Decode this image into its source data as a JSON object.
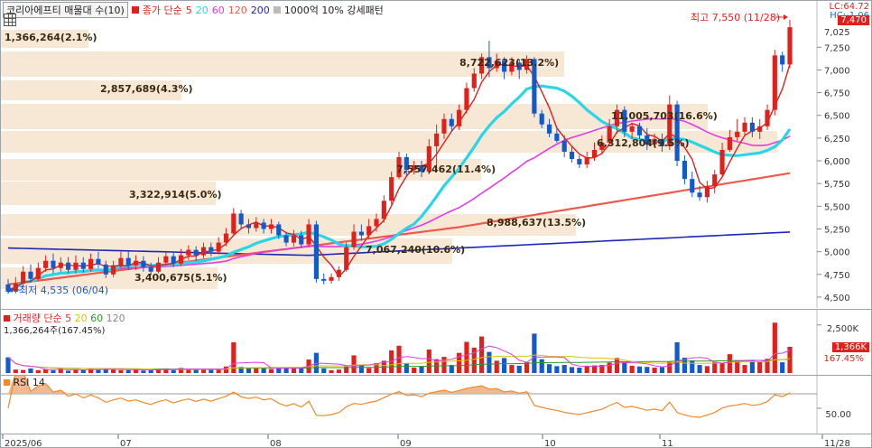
{
  "header": {
    "title": "코리아에프티 매물대 수(10)",
    "ma_label": "종가 단순",
    "ma_periods": [
      "5",
      "20",
      "60",
      "120",
      "200"
    ],
    "ma_colors": [
      "#e0201c",
      "#2ad5e8",
      "#e23de0",
      "#ec5a4c",
      "#1d27b8"
    ],
    "extra_label": "1000억 10% 강세패턴",
    "right_lc": "LC:64.72",
    "right_hc": "HC:-1.06"
  },
  "volume_legend": {
    "label": "거래량",
    "ma_label": "단순",
    "ma_periods": [
      "5",
      "20",
      "60",
      "120"
    ],
    "ma_colors": [
      "#e8302a",
      "#d7c400",
      "#2a9b2a",
      "#888888"
    ],
    "value_text": "1,366,264주(167.45%)",
    "tag_value": "1,366K",
    "tag_pct": "167.45%",
    "axis_label": "2,500K"
  },
  "rsi_legend": {
    "label": "RSI 14",
    "axis_label": "50.00"
  },
  "price_tag": "7,470",
  "price_axis": [
    "7,250",
    "7,000",
    "6,750",
    "6,500",
    "6,250",
    "6,000",
    "5,750",
    "5,500",
    "5,250",
    "5,000",
    "4,750",
    "4,500"
  ],
  "top_axis_label": "7,025",
  "annotations": {
    "high": "최고 7,550 (11/28)",
    "low": "최저 4,535 (06/04)"
  },
  "x_axis": [
    "2025/06",
    "07",
    "08",
    "09",
    "10",
    "11",
    "11/28"
  ],
  "chart_data": {
    "type": "candlestick",
    "title": "코리아에프티 매물대 수(10)",
    "ylim": [
      4420,
      7700
    ],
    "yticks": [
      4500,
      4750,
      5000,
      5250,
      5500,
      5750,
      6000,
      6250,
      6500,
      6750,
      7000,
      7250
    ],
    "high": {
      "value": 7550,
      "date": "11/28"
    },
    "low": {
      "value": 4535,
      "date": "06/04"
    },
    "candles": [
      [
        4640,
        4560,
        4700,
        4535
      ],
      [
        4560,
        4650,
        4720,
        4540
      ],
      [
        4650,
        4780,
        4840,
        4610
      ],
      [
        4780,
        4700,
        4860,
        4660
      ],
      [
        4700,
        4820,
        4880,
        4680
      ],
      [
        4820,
        4900,
        4960,
        4780
      ],
      [
        4900,
        4820,
        4980,
        4760
      ],
      [
        4820,
        4880,
        4940,
        4780
      ],
      [
        4880,
        4800,
        4940,
        4760
      ],
      [
        4800,
        4880,
        4960,
        4760
      ],
      [
        4880,
        4810,
        4940,
        4770
      ],
      [
        4810,
        4920,
        4980,
        4780
      ],
      [
        4920,
        4860,
        5000,
        4820
      ],
      [
        4860,
        4750,
        4900,
        4710
      ],
      [
        4750,
        4850,
        4900,
        4720
      ],
      [
        4850,
        4930,
        5000,
        4820
      ],
      [
        4930,
        4850,
        5000,
        4800
      ],
      [
        4850,
        4900,
        4960,
        4800
      ],
      [
        4900,
        4830,
        4950,
        4780
      ],
      [
        4830,
        4780,
        4880,
        4740
      ],
      [
        4780,
        4880,
        4940,
        4760
      ],
      [
        4880,
        4950,
        5010,
        4850
      ],
      [
        4950,
        4870,
        5000,
        4830
      ],
      [
        4870,
        4960,
        5030,
        4840
      ],
      [
        4960,
        5020,
        5070,
        4910
      ],
      [
        5020,
        4960,
        5060,
        4900
      ],
      [
        4960,
        5050,
        5100,
        4930
      ],
      [
        5050,
        5000,
        5100,
        4950
      ],
      [
        5000,
        5100,
        5160,
        4970
      ],
      [
        5100,
        5200,
        5260,
        5060
      ],
      [
        5200,
        5420,
        5480,
        5180
      ],
      [
        5420,
        5300,
        5460,
        5250
      ],
      [
        5300,
        5260,
        5360,
        5200
      ],
      [
        5260,
        5320,
        5380,
        5220
      ],
      [
        5320,
        5250,
        5360,
        5200
      ],
      [
        5250,
        5300,
        5360,
        5200
      ],
      [
        5300,
        5180,
        5330,
        5140
      ],
      [
        5180,
        5100,
        5220,
        5060
      ],
      [
        5100,
        5180,
        5240,
        5060
      ],
      [
        5180,
        5080,
        5230,
        5040
      ],
      [
        5080,
        5300,
        5360,
        5050
      ],
      [
        5300,
        4700,
        5340,
        4660
      ],
      [
        4700,
        4680,
        4760,
        4640
      ],
      [
        4680,
        4720,
        4760,
        4650
      ],
      [
        4720,
        4800,
        4840,
        4680
      ],
      [
        4800,
        5050,
        5100,
        4780
      ],
      [
        5050,
        5220,
        5300,
        5020
      ],
      [
        5220,
        5180,
        5300,
        5120
      ],
      [
        5180,
        5280,
        5360,
        5140
      ],
      [
        5280,
        5360,
        5420,
        5220
      ],
      [
        5360,
        5560,
        5620,
        5320
      ],
      [
        5560,
        5820,
        5880,
        5520
      ],
      [
        5820,
        6040,
        6100,
        5800
      ],
      [
        6040,
        5900,
        6080,
        5840
      ],
      [
        5900,
        5950,
        6000,
        5850
      ],
      [
        5950,
        5880,
        6000,
        5820
      ],
      [
        5880,
        6160,
        6240,
        5860
      ],
      [
        6160,
        6300,
        6400,
        5900
      ],
      [
        6300,
        6460,
        6520,
        6240
      ],
      [
        6460,
        6380,
        6520,
        6320
      ],
      [
        6380,
        6560,
        6620,
        6340
      ],
      [
        6560,
        6800,
        6860,
        6520
      ],
      [
        6800,
        6960,
        7020,
        6760
      ],
      [
        6960,
        7140,
        7180,
        6900
      ],
      [
        7140,
        7020,
        7320,
        6920
      ],
      [
        7020,
        7100,
        7180,
        6980
      ],
      [
        7100,
        6980,
        7140,
        6900
      ],
      [
        6980,
        7080,
        7140,
        6940
      ],
      [
        7080,
        7000,
        7120,
        6900
      ],
      [
        7000,
        7120,
        7160,
        6960
      ],
      [
        7120,
        6520,
        7140,
        6480
      ],
      [
        6520,
        6400,
        6560,
        6360
      ],
      [
        6400,
        6300,
        6460,
        6260
      ],
      [
        6300,
        6220,
        6360,
        6200
      ],
      [
        6220,
        6100,
        6280,
        6040
      ],
      [
        6100,
        6020,
        6160,
        5980
      ],
      [
        6020,
        5960,
        6060,
        5920
      ],
      [
        5960,
        6040,
        6100,
        5920
      ],
      [
        6040,
        6120,
        6200,
        6000
      ],
      [
        6120,
        6200,
        6280,
        6080
      ],
      [
        6200,
        6380,
        6460,
        6180
      ],
      [
        6380,
        6560,
        6620,
        6300
      ],
      [
        6560,
        6320,
        6600,
        6260
      ],
      [
        6320,
        6380,
        6420,
        6240
      ],
      [
        6380,
        6280,
        6420,
        6240
      ],
      [
        6280,
        6180,
        6360,
        6120
      ],
      [
        6180,
        6240,
        6300,
        6140
      ],
      [
        6240,
        6160,
        6300,
        6100
      ],
      [
        6160,
        6620,
        6720,
        6120
      ],
      [
        6620,
        6000,
        6660,
        5940
      ],
      [
        6000,
        5800,
        6060,
        5740
      ],
      [
        5800,
        5650,
        5880,
        5600
      ],
      [
        5650,
        5600,
        5720,
        5560
      ],
      [
        5600,
        5720,
        5780,
        5540
      ],
      [
        5720,
        5850,
        5900,
        5640
      ],
      [
        5850,
        6120,
        6200,
        5820
      ],
      [
        6120,
        6260,
        6340,
        6100
      ],
      [
        6260,
        6320,
        6460,
        6220
      ],
      [
        6320,
        6420,
        6480,
        6280
      ],
      [
        6420,
        6320,
        6480,
        6260
      ],
      [
        6320,
        6380,
        6460,
        6240
      ],
      [
        6380,
        6560,
        6620,
        6340
      ],
      [
        6560,
        7160,
        7220,
        6500
      ],
      [
        7160,
        7060,
        7200,
        6980
      ],
      [
        7060,
        7470,
        7550,
        7020
      ]
    ],
    "volume_ylim": [
      0,
      3100
    ],
    "volume": [
      820,
      180,
      160,
      240,
      150,
      200,
      140,
      230,
      120,
      190,
      150,
      260,
      170,
      210,
      180,
      150,
      140,
      220,
      130,
      160,
      190,
      240,
      150,
      260,
      210,
      170,
      220,
      180,
      200,
      340,
      1600,
      320,
      260,
      280,
      240,
      210,
      260,
      300,
      240,
      280,
      700,
      1050,
      240,
      150,
      180,
      340,
      920,
      400,
      260,
      520,
      640,
      1180,
      1420,
      520,
      280,
      340,
      1220,
      720,
      840,
      420,
      1050,
      1620,
      1320,
      1900,
      1100,
      640,
      780,
      420,
      380,
      560,
      2050,
      720,
      460,
      360,
      420,
      310,
      280,
      380,
      400,
      420,
      540,
      780,
      560,
      380,
      340,
      320,
      280,
      300,
      580,
      1600,
      800,
      660,
      420,
      360,
      580,
      520,
      980,
      640,
      420,
      640,
      600,
      740,
      2620,
      560,
      1366
    ],
    "rsi_ylim": [
      20,
      90
    ],
    "rsi_level": 50,
    "volume_profile": [
      {
        "text": "1,366,264(2.1%)"
      },
      {
        "text": "2,857,689(4.3%)"
      },
      {
        "text": "3,322,914(5.0%)"
      },
      {
        "text": "3,400,675(5.1%)"
      },
      {
        "text": "7,067,240(10.6%)"
      },
      {
        "text": "7,557,462(11.4%)"
      },
      {
        "text": "8,988,637(13.5%)"
      },
      {
        "text": "6,312,804(9.5%)"
      },
      {
        "text": "11,005,703(16.6%)"
      },
      {
        "text": "8,722,623(13.2%)"
      }
    ]
  }
}
